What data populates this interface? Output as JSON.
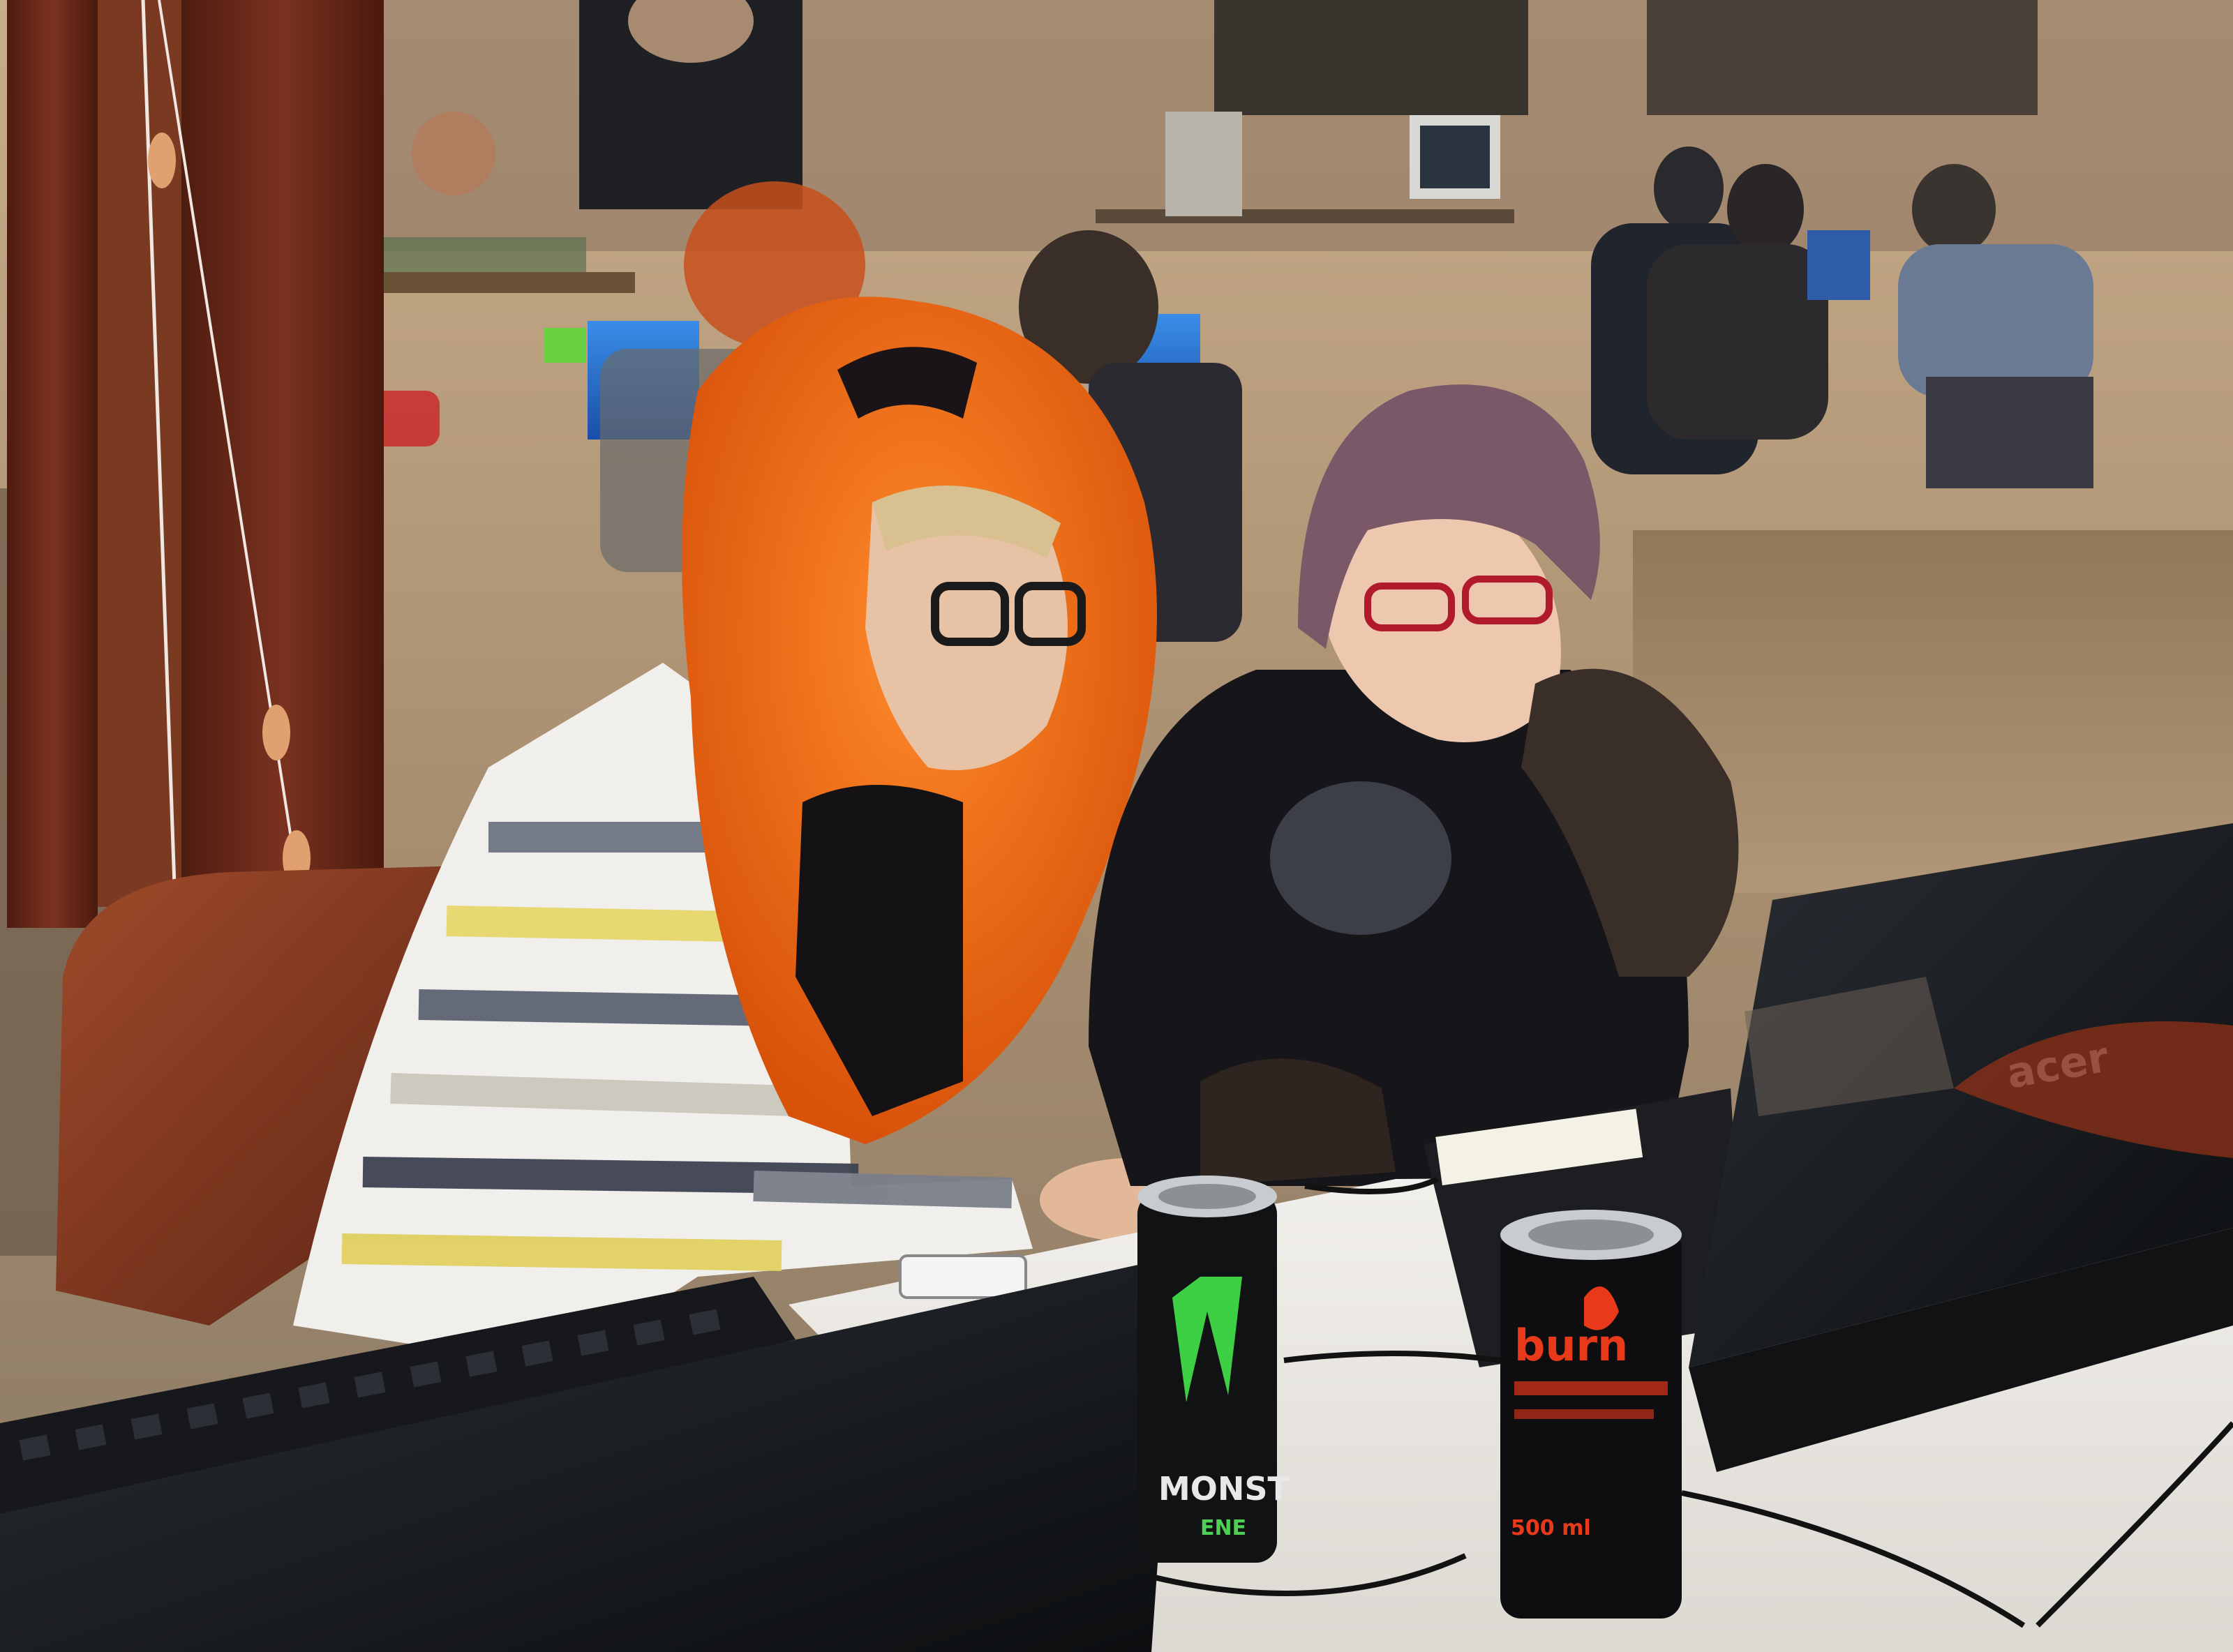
{
  "photo": {
    "palette": {
      "wall": "#c8a882",
      "wood_frame": "#6b2a18",
      "orange_fur": "#f06a10",
      "chair_leather": "#8a3a22",
      "desk": "#e8e6e2",
      "laptop_black": "#121416"
    },
    "visible_text": {
      "laptop_brand": "acer",
      "monster_can_text": "MONST",
      "monster_can_subtext": "ENE",
      "burn_can_text": "burn",
      "burn_can_volume": "500 ml"
    }
  }
}
